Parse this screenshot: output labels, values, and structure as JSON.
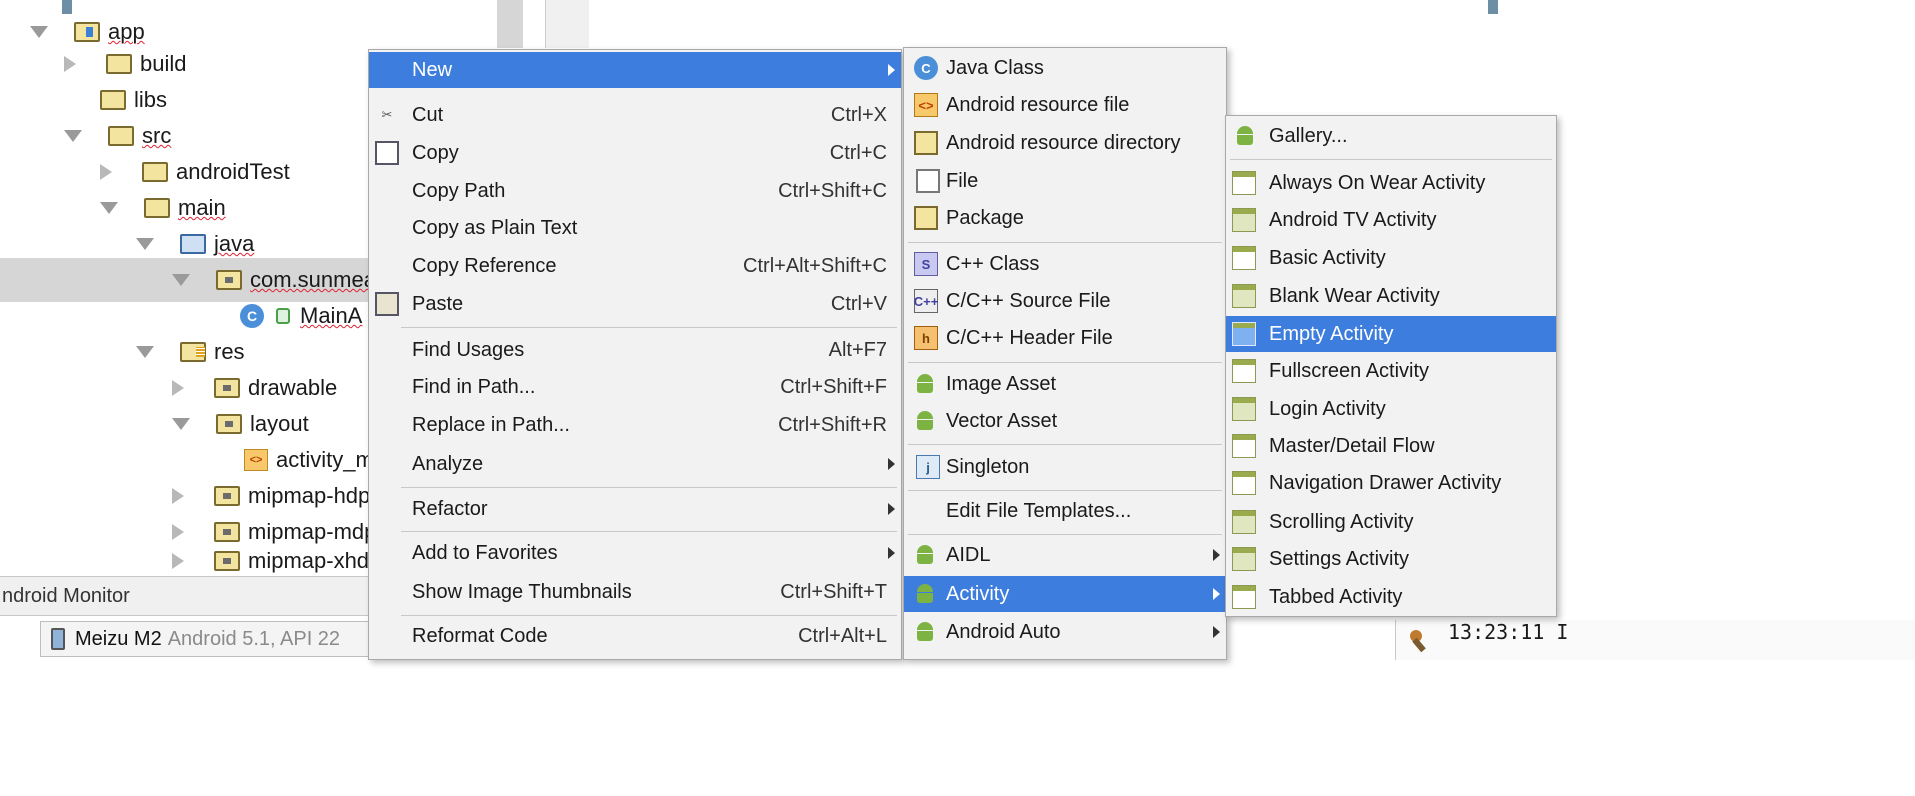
{
  "tree": [
    {
      "label": "app",
      "arrow": "down"
    },
    {
      "label": "build",
      "arrow": "right"
    },
    {
      "label": "libs",
      "arrow": "none"
    },
    {
      "label": "src",
      "arrow": "down"
    },
    {
      "label": "androidTest",
      "arrow": "right"
    },
    {
      "label": "main",
      "arrow": "down"
    },
    {
      "label": "java",
      "arrow": "down"
    },
    {
      "label": "com.sunmeat",
      "arrow": "down",
      "selected": true
    },
    {
      "label": "MainA",
      "arrow": "none"
    },
    {
      "label": "res",
      "arrow": "down"
    },
    {
      "label": "drawable",
      "arrow": "right"
    },
    {
      "label": "layout",
      "arrow": "down"
    },
    {
      "label": "activity_m",
      "arrow": "none"
    },
    {
      "label": "mipmap-hdp",
      "arrow": "right"
    },
    {
      "label": "mipmap-mdp",
      "arrow": "right"
    },
    {
      "label": "mipmap-xhdi",
      "arrow": "right"
    }
  ],
  "bottom": {
    "monitor_title": "ndroid Monitor",
    "device_name": "Meizu M2",
    "device_sub": "Android 5.1, API 22",
    "time": "13:23:11 I"
  },
  "menu1": [
    {
      "label": "New",
      "shortcut": "",
      "submenu": true,
      "highlighted": true,
      "icon": ""
    },
    {
      "label": "Cut",
      "shortcut": "Ctrl+X",
      "icon": "cut-icon"
    },
    {
      "label": "Copy",
      "shortcut": "Ctrl+C",
      "icon": "copy-icon"
    },
    {
      "label": "Copy Path",
      "shortcut": "Ctrl+Shift+C",
      "icon": ""
    },
    {
      "label": "Copy as Plain Text",
      "shortcut": "",
      "icon": ""
    },
    {
      "label": "Copy Reference",
      "shortcut": "Ctrl+Alt+Shift+C",
      "icon": ""
    },
    {
      "label": "Paste",
      "shortcut": "Ctrl+V",
      "icon": "paste-icon"
    },
    {
      "label": "Find Usages",
      "shortcut": "Alt+F7",
      "icon": ""
    },
    {
      "label": "Find in Path...",
      "shortcut": "Ctrl+Shift+F",
      "icon": ""
    },
    {
      "label": "Replace in Path...",
      "shortcut": "Ctrl+Shift+R",
      "icon": ""
    },
    {
      "label": "Analyze",
      "shortcut": "",
      "submenu": true,
      "icon": ""
    },
    {
      "label": "Refactor",
      "shortcut": "",
      "submenu": true,
      "icon": ""
    },
    {
      "label": "Add to Favorites",
      "shortcut": "",
      "submenu": true,
      "icon": ""
    },
    {
      "label": "Show Image Thumbnails",
      "shortcut": "Ctrl+Shift+T",
      "icon": ""
    },
    {
      "label": "Reformat Code",
      "shortcut": "Ctrl+Alt+L",
      "icon": ""
    }
  ],
  "menu2": [
    {
      "label": "Java Class",
      "icon": "java-class-icon"
    },
    {
      "label": "Android resource file",
      "icon": "resource-file-icon"
    },
    {
      "label": "Android resource directory",
      "icon": "resource-directory-icon"
    },
    {
      "label": "File",
      "icon": "file-icon"
    },
    {
      "label": "Package",
      "icon": "package-icon"
    },
    {
      "label": "C++ Class",
      "icon": "cpp-class-icon"
    },
    {
      "label": "C/C++ Source File",
      "icon": "cpp-source-icon"
    },
    {
      "label": "C/C++ Header File",
      "icon": "cpp-header-icon"
    },
    {
      "label": "Image Asset",
      "icon": "android-icon"
    },
    {
      "label": "Vector Asset",
      "icon": "android-icon"
    },
    {
      "label": "Singleton",
      "icon": "singleton-icon"
    },
    {
      "label": "Edit File Templates...",
      "icon": ""
    },
    {
      "label": "AIDL",
      "icon": "android-icon",
      "submenu": true
    },
    {
      "label": "Activity",
      "icon": "android-icon",
      "submenu": true,
      "highlighted": true
    },
    {
      "label": "Android Auto",
      "icon": "android-icon",
      "submenu": true
    }
  ],
  "menu3": [
    {
      "label": "Gallery...",
      "icon": "android-icon"
    },
    {
      "label": "Always On Wear Activity",
      "icon": "template-icon"
    },
    {
      "label": "Android TV Activity",
      "icon": "template-icon"
    },
    {
      "label": "Basic Activity",
      "icon": "template-icon"
    },
    {
      "label": "Blank Wear Activity",
      "icon": "template-icon"
    },
    {
      "label": "Empty Activity",
      "icon": "template-icon",
      "highlighted": true
    },
    {
      "label": "Fullscreen Activity",
      "icon": "template-icon"
    },
    {
      "label": "Login Activity",
      "icon": "template-icon"
    },
    {
      "label": "Master/Detail Flow",
      "icon": "template-icon"
    },
    {
      "label": "Navigation Drawer Activity",
      "icon": "template-icon"
    },
    {
      "label": "Scrolling Activity",
      "icon": "template-icon"
    },
    {
      "label": "Settings Activity",
      "icon": "template-icon"
    },
    {
      "label": "Tabbed Activity",
      "icon": "template-icon"
    }
  ],
  "colors": {
    "highlight": "#3d7ddd",
    "menu_bg": "#f2f2f2",
    "tree_selected": "#d6d6d6"
  }
}
